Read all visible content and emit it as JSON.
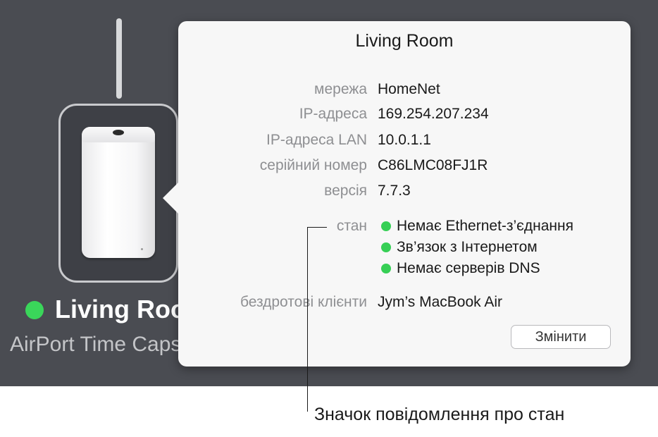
{
  "device": {
    "name": "Living Room",
    "model": "AirPort Time Capsule",
    "status_color": "#3ad65a"
  },
  "popover": {
    "title": "Living Room",
    "fields": {
      "network_label": "мережа",
      "network_value": "HomeNet",
      "ip_label": "IP-адреса",
      "ip_value": "169.254.207.234",
      "lan_ip_label": "IP-адреса LAN",
      "lan_ip_value": "10.0.1.1",
      "serial_label": "серійний номер",
      "serial_value": "C86LMC08FJ1R",
      "version_label": "версія",
      "version_value": "7.7.3",
      "status_label": "стан",
      "status_items": [
        "Немає Ethernet-з’єднання",
        "Зв’язок з Інтернетом",
        "Немає серверів DNS"
      ],
      "clients_label": "бездротові клієнти",
      "clients_value": "Jym’s MacBook Air"
    },
    "edit_button_label": "Змінити",
    "status_dot_color": "#36cf55"
  },
  "callout": {
    "text": "Значок повідомлення про стан"
  }
}
